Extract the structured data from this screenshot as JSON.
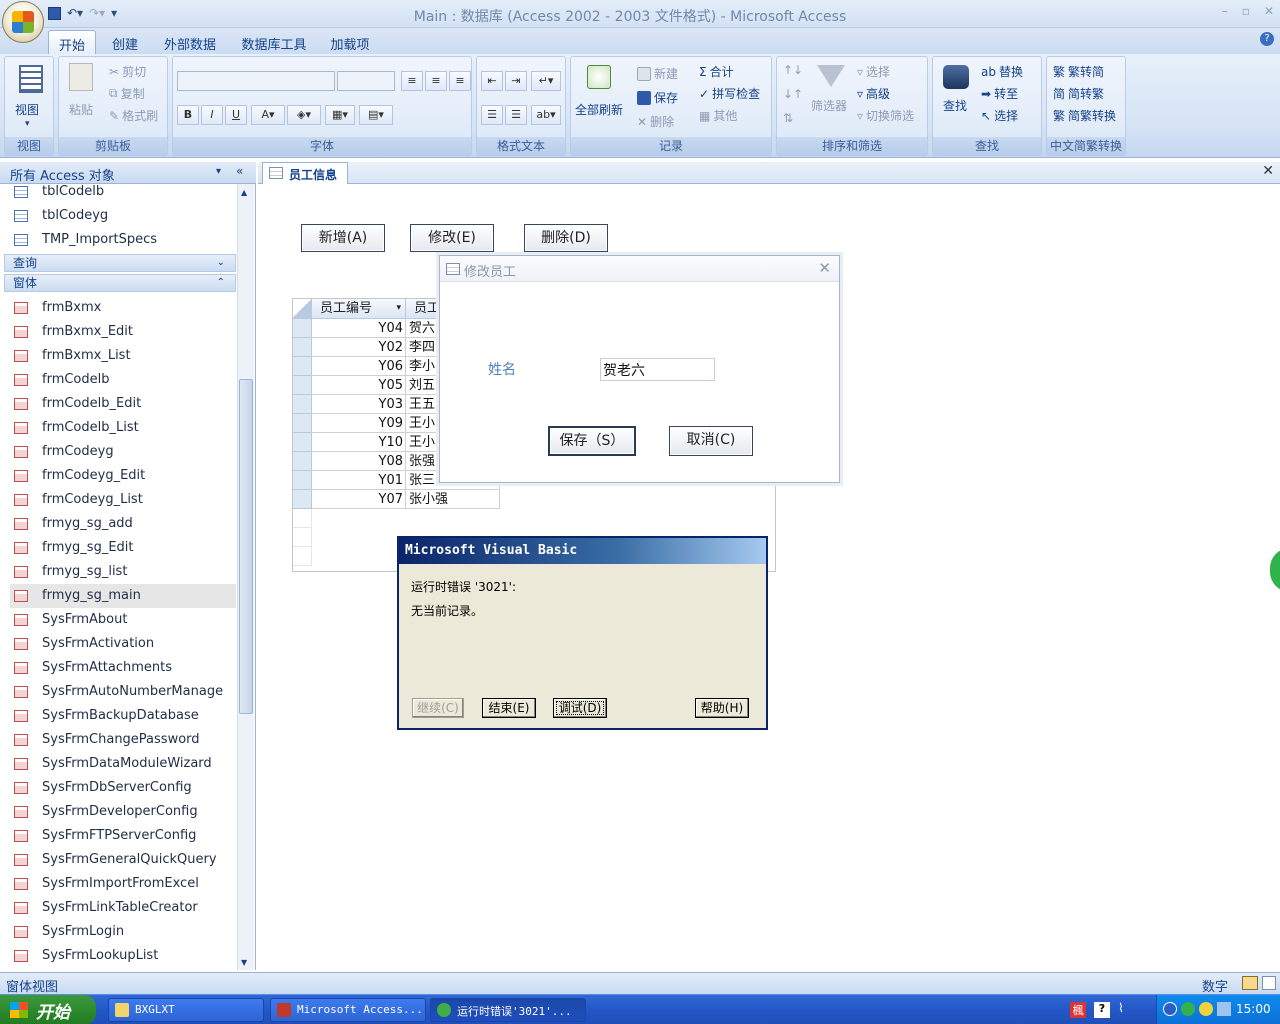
{
  "window": {
    "title": "Main : 数据库 (Access 2002 - 2003 文件格式) - Microsoft Access"
  },
  "quick_access": {
    "save_icon": "save-icon",
    "undo_icon": "undo-icon",
    "redo_icon": "redo-icon"
  },
  "ribbon_tabs": [
    "开始",
    "创建",
    "外部数据",
    "数据库工具",
    "加载项"
  ],
  "ribbon": {
    "view": {
      "label": "视图",
      "group": "视图"
    },
    "clipboard": {
      "paste": "粘贴",
      "cut": "剪切",
      "copy": "复制",
      "format_painter": "格式刷",
      "group": "剪贴板"
    },
    "font": {
      "bold": "B",
      "italic": "I",
      "underline": "U",
      "group": "字体"
    },
    "rich_text": {
      "group": "格式文本"
    },
    "records": {
      "refresh_all": "全部刷新",
      "new": "新建",
      "save": "保存",
      "delete": "删除",
      "totals": "合计",
      "spelling": "拼写检查",
      "more": "其他",
      "group": "记录"
    },
    "sort_filter": {
      "filter": "筛选器",
      "selection": "选择",
      "advanced": "高级",
      "toggle_filter": "切换筛选",
      "group": "排序和筛选"
    },
    "find": {
      "find": "查找",
      "replace": "替换",
      "goto": "转至",
      "select": "选择",
      "group": "查找"
    },
    "chinese": {
      "to_simplified": "繁转简",
      "to_traditional": "简转繁",
      "convert": "简繁转换",
      "group": "中文简繁转换"
    }
  },
  "nav": {
    "header": "所有 Access 对象",
    "tables": [
      "tblCodelb",
      "tblCodeyg",
      "TMP_ImportSpecs"
    ],
    "section_queries": "查询",
    "section_forms": "窗体",
    "forms": [
      "frmBxmx",
      "frmBxmx_Edit",
      "frmBxmx_List",
      "frmCodelb",
      "frmCodelb_Edit",
      "frmCodelb_List",
      "frmCodeyg",
      "frmCodeyg_Edit",
      "frmCodeyg_List",
      "frmyg_sg_add",
      "frmyg_sg_Edit",
      "frmyg_sg_list",
      "frmyg_sg_main",
      "SysFrmAbout",
      "SysFrmActivation",
      "SysFrmAttachments",
      "SysFrmAutoNumberManage",
      "SysFrmBackupDatabase",
      "SysFrmChangePassword",
      "SysFrmDataModuleWizard",
      "SysFrmDbServerConfig",
      "SysFrmDeveloperConfig",
      "SysFrmFTPServerConfig",
      "SysFrmGeneralQuickQuery",
      "SysFrmImportFromExcel",
      "SysFrmLinkTableCreator",
      "SysFrmLogin",
      "SysFrmLookupList"
    ],
    "selected": "frmyg_sg_main"
  },
  "doc": {
    "tab": "员工信息",
    "buttons": {
      "add": "新增(A)",
      "edit": "修改(E)",
      "delete": "删除(D)"
    },
    "grid": {
      "headers": [
        "员工编号",
        "员工"
      ],
      "rows": [
        [
          "Y04",
          "贺六"
        ],
        [
          "Y02",
          "李四"
        ],
        [
          "Y06",
          "李小"
        ],
        [
          "Y05",
          "刘五"
        ],
        [
          "Y03",
          "王五"
        ],
        [
          "Y09",
          "王小"
        ],
        [
          "Y10",
          "王小"
        ],
        [
          "Y08",
          "张强"
        ],
        [
          "Y01",
          "张三"
        ],
        [
          "Y07",
          "张小强"
        ]
      ]
    }
  },
  "edit_dialog": {
    "title": "修改员工",
    "name_label": "姓名",
    "name_value": "贺老六",
    "save": "保存（S）",
    "cancel": "取消(C)"
  },
  "vb_error": {
    "title": "Microsoft Visual Basic",
    "line1": "运行时错误 '3021':",
    "line2": "无当前记录。",
    "continue": "继续(C)",
    "end": "结束(E)",
    "debug": "调试(D)",
    "help": "帮助(H)"
  },
  "status": {
    "left": "窗体视图",
    "right": "数字"
  },
  "taskbar": {
    "start": "开始",
    "tasks": [
      "BXGLXT",
      "Microsoft Access...",
      "运行时错误'3021'..."
    ],
    "clock": "15:00"
  }
}
